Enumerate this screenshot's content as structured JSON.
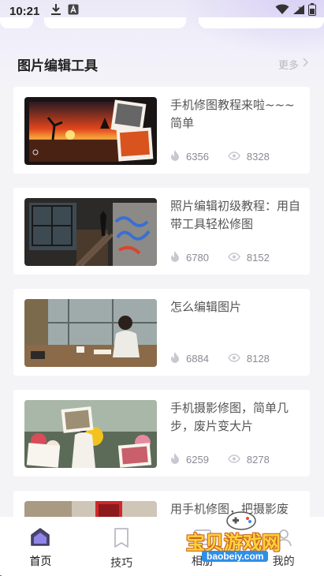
{
  "status_bar": {
    "time": "10:21"
  },
  "section": {
    "title": "图片编辑工具",
    "more_label": "更多"
  },
  "articles": [
    {
      "title": "手机修图教程来啦~~~简单",
      "likes": "6356",
      "views": "8328"
    },
    {
      "title": "照片编辑初级教程：用自带工具轻松修图",
      "likes": "6780",
      "views": "8152"
    },
    {
      "title": "怎么编辑图片",
      "likes": "6884",
      "views": "8128"
    },
    {
      "title": "手机摄影修图，简单几步，废片变大片",
      "likes": "6259",
      "views": "8278"
    },
    {
      "title": "用手机修图，把摄影废",
      "likes": "",
      "views": ""
    }
  ],
  "nav": {
    "items": [
      {
        "label": "首页",
        "icon": "home-icon"
      },
      {
        "label": "技巧",
        "icon": "bookmark-icon"
      },
      {
        "label": "相册",
        "icon": "album-icon"
      },
      {
        "label": "我的",
        "icon": "profile-icon"
      }
    ]
  },
  "watermark": {
    "title": "宝贝游戏网",
    "url": "baobeiy.com"
  },
  "colors": {
    "accent": "#6b5fd6",
    "background": "#f4f4f7",
    "card": "#ffffff",
    "muted_text": "#8a8a94"
  }
}
